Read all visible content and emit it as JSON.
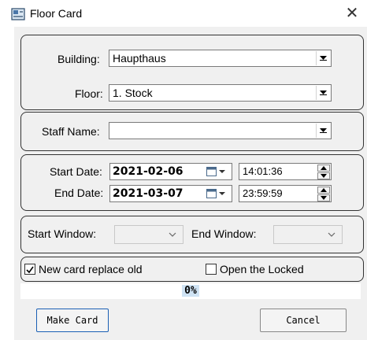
{
  "window": {
    "title": "Floor Card",
    "close_glyph": "✕"
  },
  "location": {
    "building_label": "Building:",
    "building_value": "Haupthaus",
    "floor_label": "Floor:",
    "floor_value": "1. Stock"
  },
  "staff": {
    "label": "Staff Name:",
    "value": ""
  },
  "dates": {
    "start_label": "Start Date:",
    "start_date": "2021-02-06",
    "start_time": "14:01:36",
    "end_label": "End Date:",
    "end_date": "2021-03-07",
    "end_time": "23:59:59"
  },
  "windows": {
    "start_label": "Start Window:",
    "end_label": "End Window:"
  },
  "options": {
    "replace_label": "New card replace old",
    "replace_checked": true,
    "open_locked_label": "Open the Locked",
    "open_locked_checked": false
  },
  "progress": {
    "text": "0%",
    "value": 0
  },
  "buttons": {
    "make": "Make Card",
    "cancel": "Cancel"
  },
  "colors": {
    "accent": "#1a5fb4",
    "progress_fill": "#cfe3f4"
  },
  "icons": {
    "app": "card-app-icon",
    "close": "close-icon"
  }
}
